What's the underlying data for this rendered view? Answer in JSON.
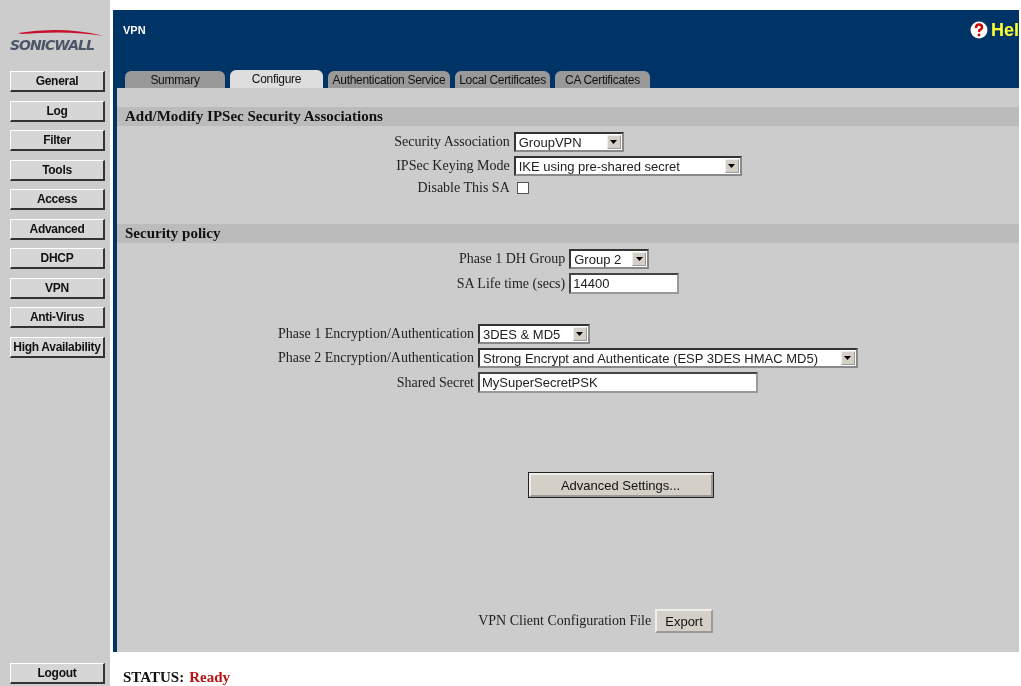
{
  "window": {
    "title": "VPN"
  },
  "logo": {
    "text": "SONICWALL"
  },
  "help": {
    "label": "Hel"
  },
  "sidebar": {
    "items": [
      {
        "label": "General"
      },
      {
        "label": "Log"
      },
      {
        "label": "Filter"
      },
      {
        "label": "Tools"
      },
      {
        "label": "Access"
      },
      {
        "label": "Advanced"
      },
      {
        "label": "DHCP"
      },
      {
        "label": "VPN"
      },
      {
        "label": "Anti-Virus"
      },
      {
        "label": "High Availability"
      }
    ],
    "logout": "Logout"
  },
  "tabs": [
    {
      "label": "Summary",
      "selected": false
    },
    {
      "label": "Configure",
      "selected": true
    },
    {
      "label": "Authentication Service",
      "selected": false
    },
    {
      "label": "Local Certificates",
      "selected": false
    },
    {
      "label": "CA Certificates",
      "selected": false
    }
  ],
  "sections": [
    {
      "title": "Add/Modify IPSec Security Associations",
      "groups": [
        [
          {
            "kind": "select",
            "label": "Security Association",
            "value": "GroupVPN"
          },
          {
            "kind": "select",
            "label": "IPSec Keying Mode",
            "value": "IKE using pre-shared secret"
          },
          {
            "kind": "checkbox",
            "label": "Disable This SA",
            "checked": false
          }
        ]
      ]
    },
    {
      "title": "Security policy",
      "groups": [
        [
          {
            "kind": "select",
            "label": "Phase 1 DH Group",
            "value": "Group 2"
          },
          {
            "kind": "input",
            "label": "SA Life time (secs)",
            "value": "14400"
          }
        ],
        [
          {
            "kind": "select",
            "label": "Phase 1 Encryption/Authentication",
            "value": "3DES & MD5"
          },
          {
            "kind": "select",
            "label": "Phase 2 Encryption/Authentication",
            "value": "Strong Encrypt and Authenticate (ESP 3DES HMAC MD5)"
          },
          {
            "kind": "input",
            "label": "Shared Secret",
            "value": "MySuperSecretPSK"
          }
        ]
      ]
    }
  ],
  "advanced_button": "Advanced Settings...",
  "export": {
    "label": "VPN Client Configuration File",
    "button": "Export"
  },
  "status": {
    "label": "STATUS:",
    "value": "Ready"
  }
}
